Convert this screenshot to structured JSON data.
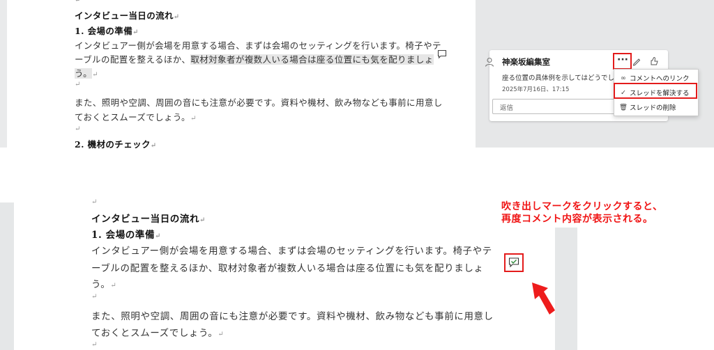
{
  "top_doc": {
    "para_mark": "↵",
    "heading": "インタビュー当日の流れ",
    "section1": "1.  会場の準備",
    "line1": "インタビュアー側が会場を用意する場合、まずは会場のセッティングを行います。椅子やテ",
    "line2_plain": "ーブルの配置を整えるほか、",
    "line2_highlight": "取材対象者が複数人いる場合は座る位置にも気を配りましょ",
    "line3_highlight": "う。",
    "line4": "また、照明や空調、周囲の音にも注意が必要です。資料や機材、飲み物なども事前に用意し",
    "line5": "ておくとスムーズでしょう。",
    "section2": "2.  機材のチェック"
  },
  "comment_card": {
    "author": "神楽坂編集室",
    "text": "座る位置の具体例を示してはどうでしょう",
    "date": "2025年7月16日、17:15",
    "reply_placeholder": "返信"
  },
  "context_menu": {
    "items": [
      "コメントへのリンク",
      "スレッドを解決する",
      "スレッドの削除"
    ]
  },
  "bottom_doc": {
    "para_mark": "↵",
    "heading": "インタビュー当日の流れ",
    "section1": "1.  会場の準備",
    "line1": "インタビュアー側が会場を用意する場合、まずは会場のセッティングを行います。椅子やテ",
    "line2": "ーブルの配置を整えるほか、取材対象者が複数人いる場合は座る位置にも気を配りましょ",
    "line3": "う。",
    "line4": "また、照明や空調、周囲の音にも注意が必要です。資料や機材、飲み物なども事前に用意し",
    "line5": "ておくとスムーズでしょう。"
  },
  "annotation": {
    "line1": "吹き出しマークをクリックすると、",
    "line2": "再度コメント内容が表示される。"
  },
  "colors": {
    "annotation_red": "#f01414",
    "highlight": "#e6e6e6",
    "sidebar": "#e6e7e8",
    "resolved_icon": "#2e8b3a"
  },
  "icons": [
    "comment-icon",
    "more-icon",
    "edit-icon",
    "like-icon",
    "avatar-icon",
    "link-icon",
    "check-icon",
    "trash-icon",
    "resolved-comment-icon",
    "red-arrow"
  ]
}
